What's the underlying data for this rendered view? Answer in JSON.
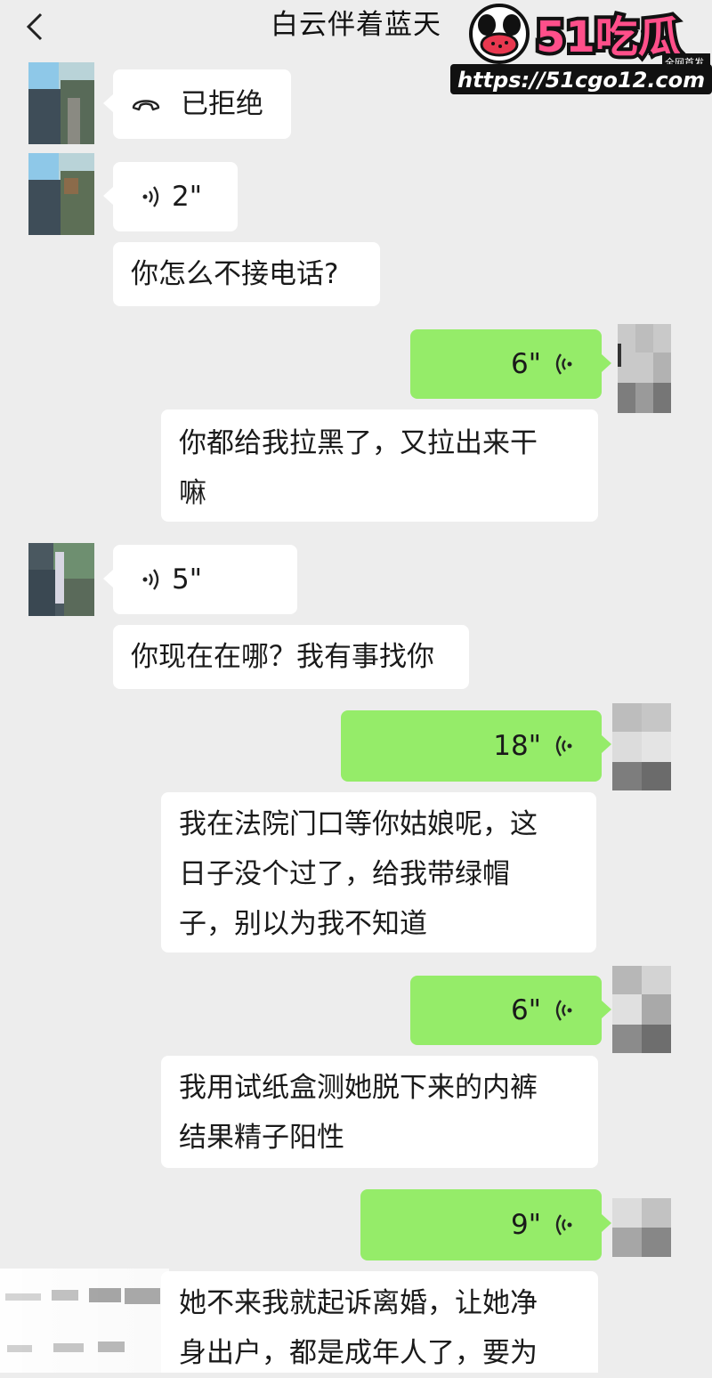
{
  "header": {
    "title": "白云伴着蓝天"
  },
  "watermark": {
    "brand": "51吃瓜",
    "tag": "全网首发",
    "url": "https://51cgo12.com"
  },
  "messages": [
    {
      "side": "left",
      "kind": "call",
      "text": "已拒绝"
    },
    {
      "side": "left",
      "kind": "voice",
      "duration": "2\""
    },
    {
      "side": "left",
      "kind": "text",
      "text": "你怎么不接电话?"
    },
    {
      "side": "right",
      "kind": "voice",
      "duration": "6\""
    },
    {
      "side": "right",
      "kind": "text",
      "lines": [
        "你都给我拉黑了，又拉出来干",
        "嘛"
      ]
    },
    {
      "side": "left",
      "kind": "voice",
      "duration": "5\""
    },
    {
      "side": "left",
      "kind": "text",
      "text": "你现在在哪？我有事找你"
    },
    {
      "side": "right",
      "kind": "voice",
      "duration": "18\""
    },
    {
      "side": "right",
      "kind": "text",
      "lines": [
        "我在法院门口等你姑娘呢，这",
        "日子没个过了，给我带绿帽",
        "子，别以为我不知道"
      ]
    },
    {
      "side": "right",
      "kind": "voice",
      "duration": "6\""
    },
    {
      "side": "right",
      "kind": "text",
      "lines": [
        "我用试纸盒测她脱下来的内裤",
        "结果精子阳性"
      ]
    },
    {
      "side": "right",
      "kind": "voice",
      "duration": "9\""
    },
    {
      "side": "right",
      "kind": "text",
      "lines": [
        "她不来我就起诉离婚，让她净",
        "身出户，都是成年人了，要为"
      ]
    }
  ],
  "colors": {
    "background": "#ededed",
    "received_bubble": "#ffffff",
    "sent_bubble": "#95ec69"
  }
}
